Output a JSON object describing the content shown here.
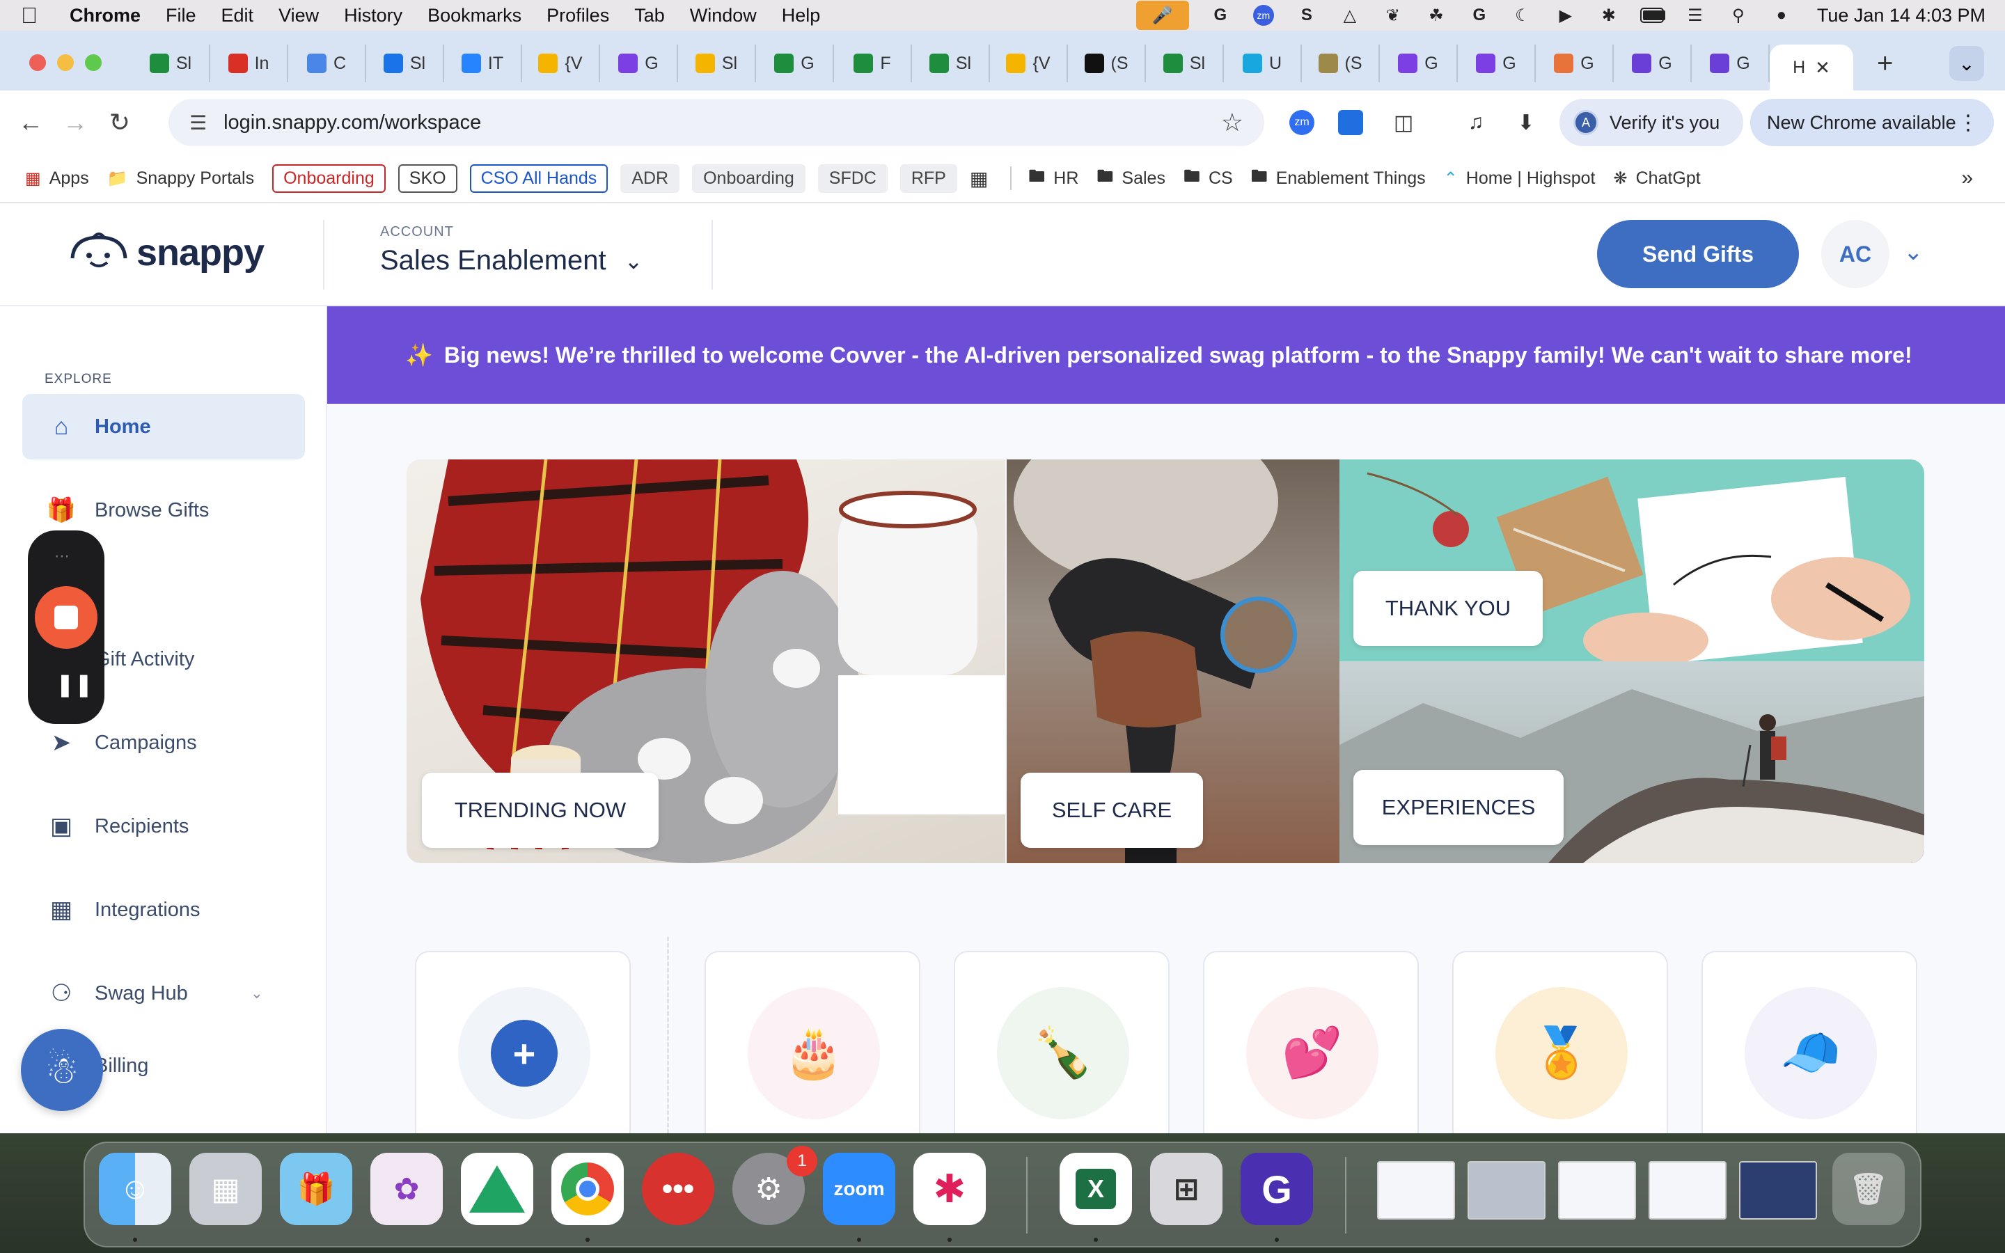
{
  "menubar": {
    "app": "Chrome",
    "items": [
      "File",
      "Edit",
      "View",
      "History",
      "Bookmarks",
      "Profiles",
      "Tab",
      "Window",
      "Help"
    ],
    "clock": "Tue Jan 14  4:03 PM"
  },
  "tabs": [
    {
      "label": "Sl",
      "icon": "sheets-icon",
      "color": "#1e8e3e"
    },
    {
      "label": "In",
      "icon": "gmail-icon",
      "color": "#d93025"
    },
    {
      "label": "C",
      "icon": "box-icon",
      "color": "#4a86e8"
    },
    {
      "label": "Sl",
      "icon": "calendar-icon",
      "color": "#1a73e8"
    },
    {
      "label": "IT",
      "icon": "jira-icon",
      "color": "#2684ff"
    },
    {
      "label": "{V",
      "icon": "slides-icon",
      "color": "#f4b400"
    },
    {
      "label": "G",
      "icon": "gong-icon",
      "color": "#7b3fe4"
    },
    {
      "label": "Sl",
      "icon": "slides-icon",
      "color": "#f4b400"
    },
    {
      "label": "G",
      "icon": "sheets-icon",
      "color": "#1e8e3e"
    },
    {
      "label": "F",
      "icon": "sheets-icon",
      "color": "#1e8e3e"
    },
    {
      "label": "Sl",
      "icon": "sheets-icon",
      "color": "#1e8e3e"
    },
    {
      "label": "{V",
      "icon": "slides-icon",
      "color": "#f4b400"
    },
    {
      "label": "(S",
      "icon": "notion-icon",
      "color": "#111111"
    },
    {
      "label": "Sl",
      "icon": "sheets-icon",
      "color": "#1e8e3e"
    },
    {
      "label": "U",
      "icon": "u-icon",
      "color": "#19a7e0"
    },
    {
      "label": "(S",
      "icon": "money-icon",
      "color": "#9c8a4a"
    },
    {
      "label": "G",
      "icon": "gong-icon",
      "color": "#7b3fe4"
    },
    {
      "label": "G",
      "icon": "gong-icon",
      "color": "#7b3fe4"
    },
    {
      "label": "G",
      "icon": "rainbow-icon",
      "color": "#e8733a"
    },
    {
      "label": "G",
      "icon": "g-icon",
      "color": "#6a3fd8"
    },
    {
      "label": "G",
      "icon": "g-icon",
      "color": "#6a3fd8"
    }
  ],
  "active_tab": {
    "label": "H"
  },
  "toolbar": {
    "url": "login.snappy.com/workspace",
    "verify_label": "Verify it's you",
    "verify_avatar": "A",
    "new_chrome_label": "New Chrome available"
  },
  "bookmarks": {
    "apps": "Apps",
    "snappy_portals": "Snappy Portals",
    "chips": [
      {
        "label": "Onboarding",
        "style": "red"
      },
      {
        "label": "SKO",
        "style": "gray"
      },
      {
        "label": "CSO All Hands",
        "style": "blue"
      },
      {
        "label": "ADR",
        "style": "plain"
      },
      {
        "label": "Onboarding",
        "style": "plain"
      },
      {
        "label": "SFDC",
        "style": "plain"
      },
      {
        "label": "RFP",
        "style": "plain"
      }
    ],
    "folders": [
      "HR",
      "Sales",
      "CS",
      "Enablement Things"
    ],
    "links": [
      "Home | Highspot",
      "ChatGpt"
    ]
  },
  "header": {
    "logo_text": "snappy",
    "account_label": "ACCOUNT",
    "account_value": "Sales Enablement",
    "send_gifts": "Send Gifts",
    "user_initials": "AC"
  },
  "sidebar": {
    "section": "EXPLORE",
    "items": [
      {
        "label": "Home",
        "icon": "home-icon"
      },
      {
        "label": "Browse Gifts",
        "icon": "gift-icon"
      },
      {
        "label": "Gift Activity",
        "icon": "activity-icon"
      },
      {
        "label": "Campaigns",
        "icon": "rocket-icon"
      },
      {
        "label": "Recipients",
        "icon": "person-icon"
      },
      {
        "label": "Integrations",
        "icon": "grid-icon"
      },
      {
        "label": "Swag Hub",
        "icon": "swag-icon"
      },
      {
        "label": "Billing",
        "icon": "billing-icon"
      }
    ]
  },
  "banner": {
    "text": "Big news! We’re thrilled to welcome Covver - the AI-driven personalized swag platform - to the Snappy family! We can't wait to share more!"
  },
  "hero": {
    "tiles": [
      {
        "label": "TRENDING NOW"
      },
      {
        "label": "SELF CARE"
      },
      {
        "label": "THANK YOU"
      },
      {
        "label": "EXPERIENCES"
      }
    ]
  },
  "categories": [
    {
      "icon": "plus-icon",
      "bg": "#f3f5f9"
    },
    {
      "icon": "cake-icon",
      "bg": "#fcf1f4"
    },
    {
      "icon": "champagne-icon",
      "bg": "#eef6ef"
    },
    {
      "icon": "heart-bubble-icon",
      "bg": "#fdf0f0"
    },
    {
      "icon": "medal-icon",
      "bg": "#fcefd6"
    },
    {
      "icon": "cap-icon",
      "bg": "#f3f1fa"
    }
  ],
  "dock": {
    "settings_badge": "1",
    "zoom_label": "zoom"
  }
}
